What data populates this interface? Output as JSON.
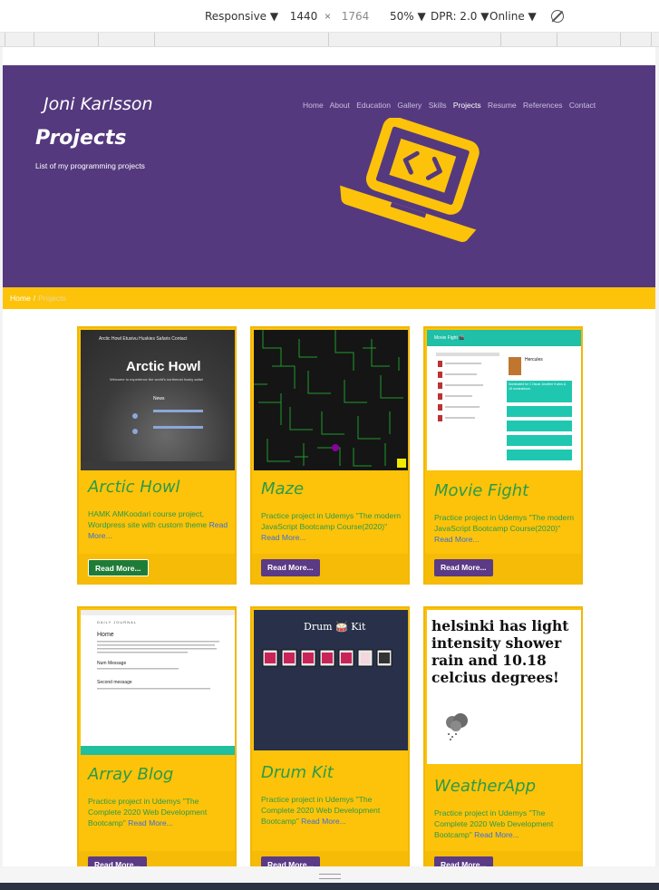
{
  "devtools": {
    "device": "Responsive",
    "width": "1440",
    "height": "1764",
    "zoom": "50%",
    "dpr": "DPR: 2.0",
    "network": "Online"
  },
  "site": {
    "logo": "Joni Karlsson",
    "nav": [
      "Home",
      "About",
      "Education",
      "Gallery",
      "Skills",
      "Projects",
      "Resume",
      "References",
      "Contact"
    ],
    "active_nav": "Projects",
    "hero_title": "Projects",
    "hero_subtitle": "List of my programming projects",
    "breadcrumb": {
      "home": "Home",
      "separator": "/",
      "current": "Projects"
    },
    "accent_colors": {
      "hero": "#55397e",
      "gold": "#fcc30a",
      "green_text": "#2c9a4a",
      "button": "#5b3a86"
    }
  },
  "projects": [
    {
      "title": "Arctic Howl",
      "description": "HAMK AMKoodari course project, Wordpress site with custom theme",
      "more": "Read More...",
      "button": "Read More...",
      "thumb": {
        "heading": "Arctic Howl",
        "caption": "Welcome to experience the world's northmost husky safari",
        "news": "News",
        "nav": "Arctic Howl   Etusivu   Huskies   Safaris   Contact"
      }
    },
    {
      "title": "Maze",
      "description": "Practice project in Udemys \"The modern JavaScript Bootcamp Course(2020)\"",
      "more": "Read More...",
      "button": "Read More..."
    },
    {
      "title": "Movie Fight",
      "description": "Practice project in Udemys \"The modern JavaScript Bootcamp Course(2020)\"",
      "more": "Read More...",
      "button": "Read More...",
      "thumb": {
        "bar": "Movie Fight 🎬",
        "movie": "Hercules",
        "award": "Nominated for 1 Oscar. Another 9 wins & 15 nominations."
      }
    },
    {
      "title": "Array Blog",
      "description": "Practice project in Udemys \"The Complete 2020 Web Development Bootcamp\"",
      "more": "Read More...",
      "button": "Read More...",
      "thumb": {
        "brand": "DAILY JOURNAL",
        "heading": "Home",
        "post1": "Num Message",
        "post2": "Second message"
      }
    },
    {
      "title": "Drum Kit",
      "description": "Practice project in Udemys \"The Complete 2020 Web Development Bootcamp\"",
      "more": "Read More...",
      "button": "Read More...",
      "thumb": {
        "heading": "Drum 🥁 Kit"
      }
    },
    {
      "title": "WeatherApp",
      "description": "Practice project in Udemys \"The Complete 2020 Web Development Bootcamp\"",
      "more": "Read More...",
      "button": "Read More...",
      "thumb": {
        "weather_text": "helsinki has light intensity shower rain and 10.18 celcius degrees!"
      }
    }
  ]
}
